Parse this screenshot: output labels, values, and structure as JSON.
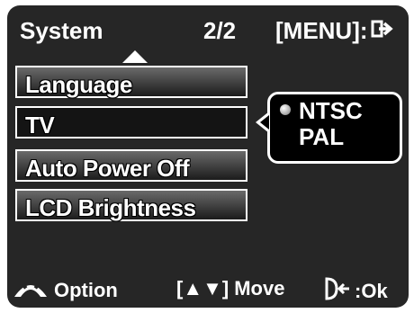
{
  "header": {
    "title": "System",
    "page": "2/2",
    "menu_label": "[MENU]:",
    "menu_icon": "exit-arrow-icon"
  },
  "menu": {
    "items": [
      {
        "label": "Language"
      },
      {
        "label": "TV"
      },
      {
        "label": "Auto Power Off"
      },
      {
        "label": "LCD Brightness"
      }
    ],
    "selected": "TV"
  },
  "tv_popup": {
    "options": [
      "NTSC",
      "PAL"
    ],
    "selected": "NTSC"
  },
  "footer": {
    "option_label": "Option",
    "option_icon": "dial-icon",
    "move_label": "Move",
    "move_icon": "[▲▼]",
    "ok_label": "Ok",
    "ok_icon": "d-arrow-icon"
  },
  "colors": {
    "background": "#262626",
    "text": "#ffffff",
    "selected_item": "#141414"
  }
}
